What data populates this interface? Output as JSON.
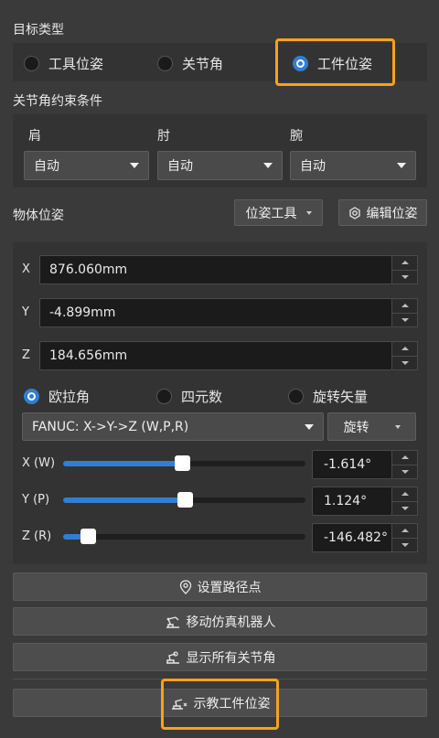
{
  "target_type": {
    "title": "目标类型",
    "options": [
      {
        "label": "工具位姿",
        "checked": false
      },
      {
        "label": "关节角",
        "checked": false
      },
      {
        "label": "工件位姿",
        "checked": true
      }
    ]
  },
  "joint_constraints": {
    "title": "关节角约束条件",
    "columns": [
      {
        "label": "肩",
        "value": "自动"
      },
      {
        "label": "肘",
        "value": "自动"
      },
      {
        "label": "腕",
        "value": "自动"
      }
    ]
  },
  "object_pose": {
    "title": "物体位姿",
    "pose_tool_label": "位姿工具",
    "edit_pose_label": "编辑位姿",
    "fields": [
      {
        "axis": "X",
        "value": "876.060mm"
      },
      {
        "axis": "Y",
        "value": "-4.899mm"
      },
      {
        "axis": "Z",
        "value": "184.656mm"
      }
    ],
    "rotation_modes": [
      {
        "label": "欧拉角",
        "checked": true
      },
      {
        "label": "四元数",
        "checked": false
      },
      {
        "label": "旋转矢量",
        "checked": false
      }
    ],
    "euler_convention": "FANUC: X->Y->Z (W,P,R)",
    "rotate_label": "旋转",
    "rotations": [
      {
        "axis": "X (W)",
        "value": "-1.614°",
        "level": 0.49
      },
      {
        "axis": "Y (P)",
        "value": "1.124°",
        "level": 0.5
      },
      {
        "axis": "Z (R)",
        "value": "-146.482°",
        "level": 0.1
      }
    ]
  },
  "actions": {
    "set_waypoint": "设置路径点",
    "move_sim_robot": "移动仿真机器人",
    "show_all_joints": "显示所有关节角",
    "teach_workpiece_pose": "示教工件位姿"
  },
  "colors": {
    "accent": "#2f7fd6",
    "highlight": "#f7a21b",
    "background": "#3a3a3a"
  }
}
